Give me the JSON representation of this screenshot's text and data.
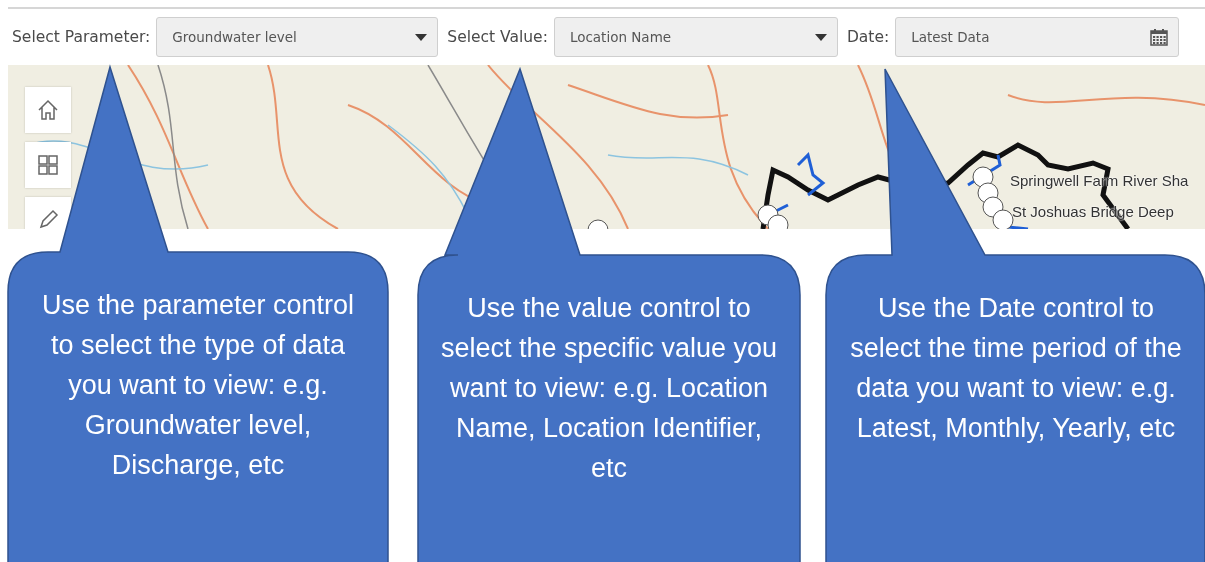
{
  "toolbar": {
    "fields": [
      {
        "kind": "dropdown",
        "label": "Select Parameter:",
        "value": "Groundwater level"
      },
      {
        "kind": "dropdown",
        "label": "Select Value:",
        "value": "Location Name"
      },
      {
        "kind": "date",
        "label": "Date:",
        "value": "Latest Data"
      }
    ]
  },
  "map": {
    "station_labels": [
      "Springwell Farm River Sha",
      "St Joshuas Bridge Deep"
    ]
  },
  "callouts": [
    {
      "text": "Use the parameter control to select the type of data you want to view: e.g. Groundwater level, Discharge, etc"
    },
    {
      "text": "Use the value control to select the specific value you want to view: e.g. Location Name, Location Identifier, etc"
    },
    {
      "text": "Use the Date control to select the time period of the data you want to view: e.g. Latest, Monthly, Yearly, etc"
    }
  ]
}
